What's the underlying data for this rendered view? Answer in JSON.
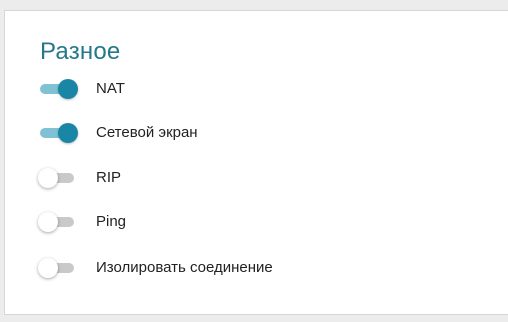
{
  "section": {
    "title": "Разное"
  },
  "toggles": [
    {
      "label": "NAT",
      "checked": true
    },
    {
      "label": "Сетевой экран",
      "checked": true
    },
    {
      "label": "RIP",
      "checked": false
    },
    {
      "label": "Ping",
      "checked": false
    },
    {
      "label": "Изолировать соединение",
      "checked": false
    }
  ],
  "colors": {
    "accent": "#1a86a6",
    "accent_track": "#7fc2d3",
    "off_track": "#c9c9c9",
    "title": "#24788a"
  }
}
